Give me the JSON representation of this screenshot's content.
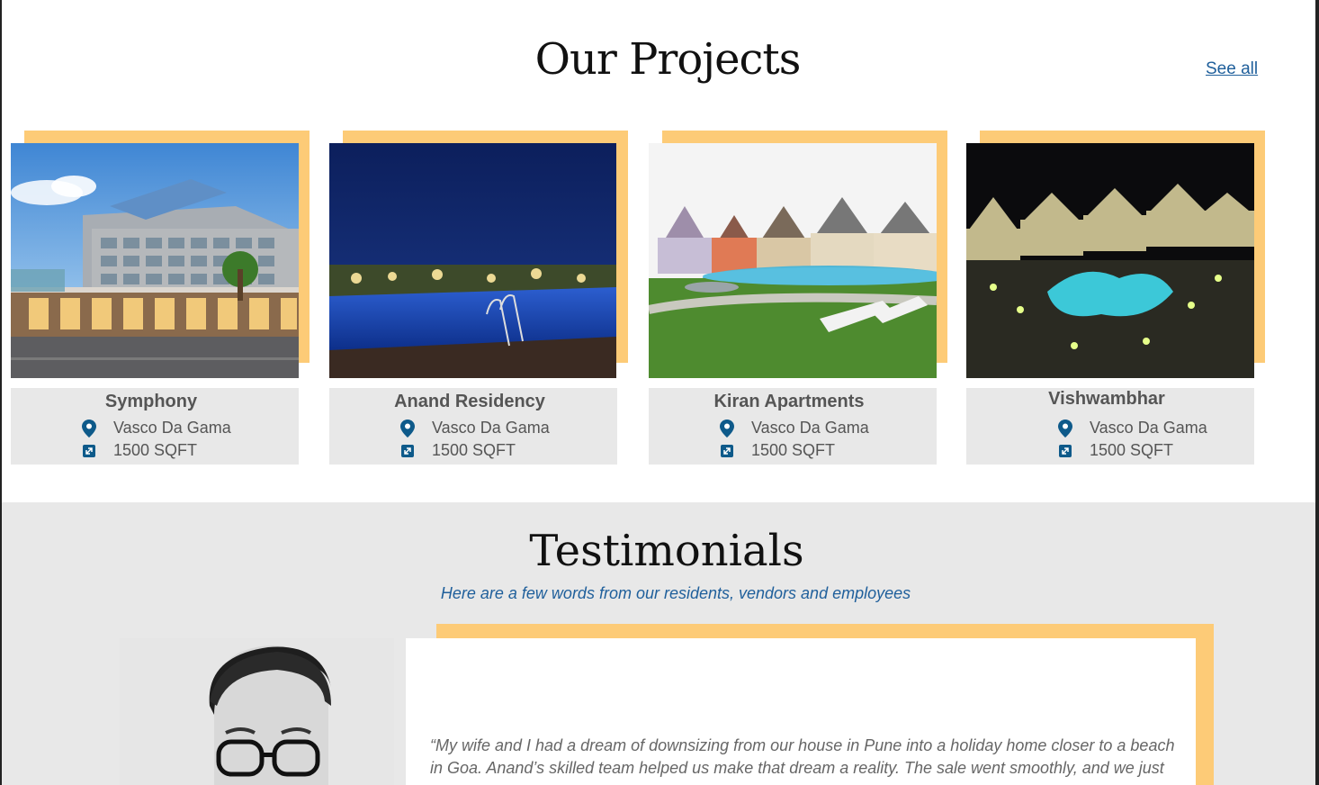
{
  "projects": {
    "title": "Our Projects",
    "see_all": "See all",
    "items": [
      {
        "name": "Symphony",
        "location": "Vasco Da Gama",
        "area": "1500 SQFT",
        "image": "office-building-photo"
      },
      {
        "name": "Anand Residency",
        "location": "Vasco Da Gama",
        "area": "1500 SQFT",
        "image": "night-pool-photo"
      },
      {
        "name": "Kiran Apartments",
        "location": "Vasco Da Gama",
        "area": "1500 SQFT",
        "image": "villas-lawn-photo"
      },
      {
        "name": "Vishwambhar",
        "location": "Vasco Da Gama",
        "area": "1500 SQFT",
        "image": "night-villas-pool-photo"
      }
    ]
  },
  "testimonials": {
    "title": "Testimonials",
    "subtitle": "Here are a few words from our residents, vendors and employees",
    "quote": "“My wife and I had a dream of downsizing from our house in Pune into a holiday home closer to a beach in Goa. Anand’s skilled team helped us make that dream a reality. The sale went smoothly, and we just"
  },
  "colors": {
    "accent": "#fdcb77",
    "link": "#1f5f9b",
    "card_bg": "#e8e8e8",
    "section_bg": "#e8e8e8"
  },
  "icons": {
    "location": "map-pin-icon",
    "area": "area-expand-icon"
  }
}
